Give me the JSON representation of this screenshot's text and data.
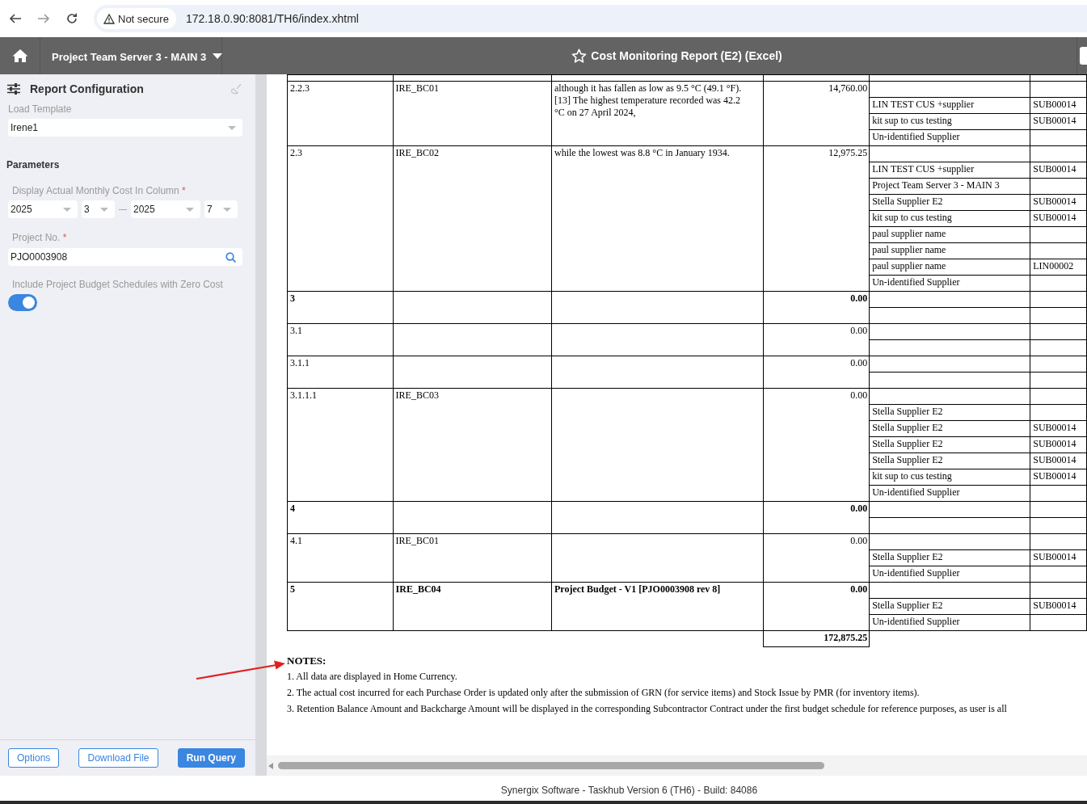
{
  "browser": {
    "security_label": "Not secure",
    "url": "172.18.0.90:8081/TH6/index.xhtml"
  },
  "header": {
    "project": "Project Team Server 3 - MAIN 3",
    "title": "Cost Monitoring Report (E2) (Excel)"
  },
  "config": {
    "title": "Report Configuration",
    "load_template": {
      "label": "Load Template",
      "value": "Irene1"
    },
    "parameters_title": "Parameters",
    "period": {
      "label": "Display Actual Monthly Cost In Column",
      "required_mark": "*",
      "from_year": "2025",
      "from_month": "3",
      "to_year": "2025",
      "to_month": "7"
    },
    "project_no": {
      "label": "Project No.",
      "required_mark": "*",
      "value": "PJO0003908"
    },
    "zero_cost": {
      "label": "Include Project Budget Schedules with Zero Cost",
      "on": true
    },
    "buttons": [
      {
        "label": "Options",
        "kind": "outline"
      },
      {
        "label": "Download File",
        "kind": "outline"
      },
      {
        "label": "Run Query",
        "kind": "primary"
      }
    ]
  },
  "report": {
    "rows": [
      {
        "code": "2.2.3",
        "budget_code": "IRE_BC01",
        "description": "although it has fallen as low as 9.5 °C (49.1 °F). [13] The highest temperature recorded was 42.2 °C on 27 April 2024,",
        "amount": "14,760.00",
        "bold": false,
        "suppliers": [
          {
            "name": "LIN TEST CUS +supplier",
            "code": "SUB00014"
          },
          {
            "name": "kit sup to cus testing",
            "code": "SUB00014"
          },
          {
            "name": "Un-identified Supplier"
          }
        ]
      },
      {
        "code": "2.3",
        "budget_code": "IRE_BC02",
        "description": "while the lowest was 8.8 °C in January 1934.",
        "amount": "12,975.25",
        "bold": false,
        "suppliers": [
          {
            "name": "LIN TEST CUS +supplier",
            "code": "SUB00014"
          },
          {
            "name": "Project Team Server 3 - MAIN 3"
          },
          {
            "name": "Stella Supplier E2",
            "code": "SUB00014"
          },
          {
            "name": "kit sup to cus testing",
            "code": "SUB00014"
          },
          {
            "name": "paul supplier name"
          },
          {
            "name": "paul supplier name"
          },
          {
            "name": "paul supplier name",
            "code": "LIN00002"
          },
          {
            "name": "Un-identified Supplier"
          }
        ]
      },
      {
        "code": "3",
        "amount": "0.00",
        "bold": true
      },
      {
        "code": "3.1",
        "amount": "0.00",
        "bold": false
      },
      {
        "code": "3.1.1",
        "amount": "0.00",
        "bold": false
      },
      {
        "code": "3.1.1.1",
        "budget_code": "IRE_BC03",
        "amount": "0.00",
        "bold": false,
        "suppliers": [
          {
            "name": "Stella Supplier E2"
          },
          {
            "name": "Stella Supplier E2",
            "code": "SUB00014"
          },
          {
            "name": "Stella Supplier E2",
            "code": "SUB00014"
          },
          {
            "name": "Stella Supplier E2",
            "code": "SUB00014"
          },
          {
            "name": "kit sup to cus testing",
            "code": "SUB00014"
          },
          {
            "name": "Un-identified Supplier"
          }
        ]
      },
      {
        "code": "4",
        "amount": "0.00",
        "bold": true
      },
      {
        "code": "4.1",
        "budget_code": "IRE_BC01",
        "amount": "0.00",
        "bold": false,
        "suppliers": [
          {
            "name": "Stella Supplier E2",
            "code": "SUB00014"
          },
          {
            "name": "Un-identified Supplier"
          }
        ]
      },
      {
        "code": "5",
        "budget_code": "IRE_BC04",
        "description": "Project Budget - V1 [PJO0003908 rev 8]",
        "amount": "0.00",
        "bold": true,
        "suppliers": [
          {
            "name": "Stella Supplier E2",
            "code": "SUB00014"
          },
          {
            "name": "Un-identified Supplier"
          }
        ]
      }
    ],
    "total": "172,875.25",
    "notes_title": "NOTES:",
    "notes": [
      "1. All data are displayed in Home Currency.",
      "2. The actual cost incurred for each Purchase Order is updated only after the submission of GRN (for service items) and Stock Issue by PMR (for inventory items).",
      "3. Retention Balance Amount and Backcharge Amount will be displayed in the corresponding Subcontractor Contract under the first budget schedule for reference purposes, as user is all"
    ]
  },
  "footer": "Synergix Software - Taskhub Version 6 (TH6) - Build: 84086"
}
